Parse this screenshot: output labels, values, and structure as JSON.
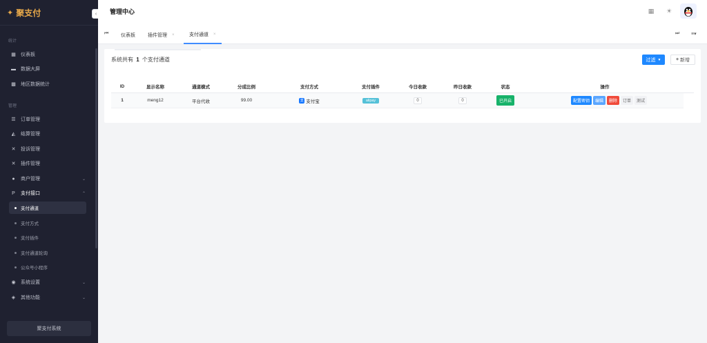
{
  "sidebar": {
    "logo_text": "聚支付",
    "group_stats": "统计",
    "group_manage": "管理",
    "items": [
      {
        "label": "仪表板",
        "icon": "dashboard-icon"
      },
      {
        "label": "数据大屏",
        "icon": "screen-icon"
      },
      {
        "label": "地区数据统计",
        "icon": "map-icon"
      },
      {
        "label": "订单管理",
        "icon": "list-icon"
      },
      {
        "label": "结算管理",
        "icon": "settle-icon"
      },
      {
        "label": "投诉管理",
        "icon": "tools-icon"
      },
      {
        "label": "插件管理",
        "icon": "tools-icon"
      },
      {
        "label": "商户管理",
        "icon": "user-icon"
      },
      {
        "label": "支付接口",
        "icon": "paypal-icon"
      },
      {
        "label": "系统设置",
        "icon": "settings-icon"
      },
      {
        "label": "其他功能",
        "icon": "layers-icon"
      }
    ],
    "sub_items": [
      "支付通道",
      "支付方式",
      "支付插件",
      "支付通道轮询",
      "公众号小程序"
    ],
    "footer": "聚支付系统"
  },
  "header": {
    "title": "管理中心"
  },
  "tabs": [
    {
      "label": "仪表板"
    },
    {
      "label": "插件管理"
    },
    {
      "label": "支付通道"
    }
  ],
  "summary": {
    "prefix": "系统共有",
    "count": "1",
    "suffix": "个支付通道"
  },
  "toolbar": {
    "filter_label": "过滤",
    "add_label": "新增"
  },
  "table": {
    "columns": [
      "ID",
      "显示名称",
      "通道模式",
      "分成比例",
      "支付方式",
      "支付插件",
      "今日收款",
      "昨日收款",
      "状态",
      "操作"
    ],
    "rows": [
      {
        "id": "1",
        "name": "meng12",
        "mode": "平台代收",
        "ratio": "99.00",
        "method": "支付宝",
        "plugin": "alipay",
        "today": "0",
        "yesterday": "0",
        "status": "已开启",
        "actions": [
          "配置密钥",
          "编辑",
          "删除",
          "订单",
          "测试"
        ]
      }
    ]
  },
  "colors": {
    "accent": "#1e88ff",
    "sidebar_bg": "#1f2130",
    "status_on": "#17b26a",
    "danger": "#f04a3a"
  }
}
